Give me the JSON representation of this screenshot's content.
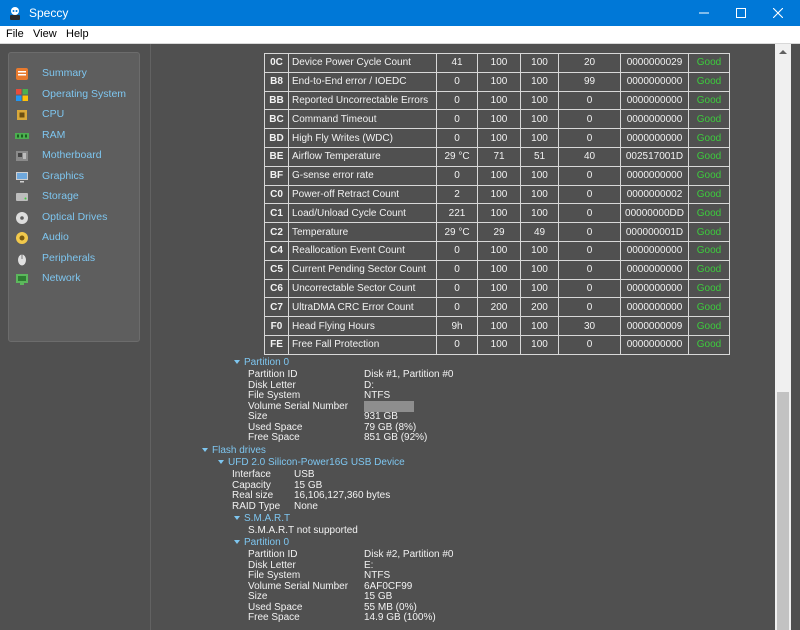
{
  "window": {
    "title": "Speccy"
  },
  "menu": [
    "File",
    "View",
    "Help"
  ],
  "sidebar": [
    {
      "label": "Summary",
      "icon": "summary-icon",
      "color": "#e87a2e"
    },
    {
      "label": "Operating System",
      "icon": "windows-icon",
      "color": "#4fa3e0"
    },
    {
      "label": "CPU",
      "icon": "cpu-icon",
      "color": "#d9a83a"
    },
    {
      "label": "RAM",
      "icon": "ram-icon",
      "color": "#4caf50"
    },
    {
      "label": "Motherboard",
      "icon": "motherboard-icon",
      "color": "#8a8a8a"
    },
    {
      "label": "Graphics",
      "icon": "graphics-icon",
      "color": "#6fa8dc"
    },
    {
      "label": "Storage",
      "icon": "storage-icon",
      "color": "#bdbdbd"
    },
    {
      "label": "Optical Drives",
      "icon": "optical-drive-icon",
      "color": "#dddddd"
    },
    {
      "label": "Audio",
      "icon": "audio-icon",
      "color": "#f2c94c"
    },
    {
      "label": "Peripherals",
      "icon": "peripherals-icon",
      "color": "#e0e0e0"
    },
    {
      "label": "Network",
      "icon": "network-icon",
      "color": "#5cb85c"
    }
  ],
  "smart_rows": [
    {
      "id": "0C",
      "name": "Device Power Cycle Count",
      "current": "41",
      "worst": "100",
      "threshold": "100",
      "low": "20",
      "raw": "0000000029",
      "status": "Good"
    },
    {
      "id": "B8",
      "name": "End-to-End error / IOEDC",
      "current": "0",
      "worst": "100",
      "threshold": "100",
      "low": "99",
      "raw": "0000000000",
      "status": "Good"
    },
    {
      "id": "BB",
      "name": "Reported Uncorrectable Errors",
      "current": "0",
      "worst": "100",
      "threshold": "100",
      "low": "0",
      "raw": "0000000000",
      "status": "Good"
    },
    {
      "id": "BC",
      "name": "Command Timeout",
      "current": "0",
      "worst": "100",
      "threshold": "100",
      "low": "0",
      "raw": "0000000000",
      "status": "Good"
    },
    {
      "id": "BD",
      "name": "High Fly Writes (WDC)",
      "current": "0",
      "worst": "100",
      "threshold": "100",
      "low": "0",
      "raw": "0000000000",
      "status": "Good"
    },
    {
      "id": "BE",
      "name": "Airflow Temperature",
      "current": "29 °C",
      "worst": "71",
      "threshold": "51",
      "low": "40",
      "raw": "002517001D",
      "status": "Good"
    },
    {
      "id": "BF",
      "name": "G-sense error rate",
      "current": "0",
      "worst": "100",
      "threshold": "100",
      "low": "0",
      "raw": "0000000000",
      "status": "Good"
    },
    {
      "id": "C0",
      "name": "Power-off Retract Count",
      "current": "2",
      "worst": "100",
      "threshold": "100",
      "low": "0",
      "raw": "0000000002",
      "status": "Good"
    },
    {
      "id": "C1",
      "name": "Load/Unload Cycle Count",
      "current": "221",
      "worst": "100",
      "threshold": "100",
      "low": "0",
      "raw": "00000000DD",
      "status": "Good"
    },
    {
      "id": "C2",
      "name": "Temperature",
      "current": "29 °C",
      "worst": "29",
      "threshold": "49",
      "low": "0",
      "raw": "000000001D",
      "status": "Good"
    },
    {
      "id": "C4",
      "name": "Reallocation Event Count",
      "current": "0",
      "worst": "100",
      "threshold": "100",
      "low": "0",
      "raw": "0000000000",
      "status": "Good"
    },
    {
      "id": "C5",
      "name": "Current Pending Sector Count",
      "current": "0",
      "worst": "100",
      "threshold": "100",
      "low": "0",
      "raw": "0000000000",
      "status": "Good"
    },
    {
      "id": "C6",
      "name": "Uncorrectable Sector Count",
      "current": "0",
      "worst": "100",
      "threshold": "100",
      "low": "0",
      "raw": "0000000000",
      "status": "Good"
    },
    {
      "id": "C7",
      "name": "UltraDMA CRC Error Count",
      "current": "0",
      "worst": "200",
      "threshold": "200",
      "low": "0",
      "raw": "0000000000",
      "status": "Good"
    },
    {
      "id": "F0",
      "name": "Head Flying Hours",
      "current": "9h",
      "worst": "100",
      "threshold": "100",
      "low": "30",
      "raw": "0000000009",
      "status": "Good"
    },
    {
      "id": "FE",
      "name": "Free Fall Protection",
      "current": "0",
      "worst": "100",
      "threshold": "100",
      "low": "0",
      "raw": "0000000000",
      "status": "Good"
    }
  ],
  "partition1": {
    "heading": "Partition 0",
    "labels": [
      "Partition ID",
      "Disk Letter",
      "File System",
      "Volume Serial Number",
      "Size",
      "Used Space",
      "Free Space"
    ],
    "values": [
      "Disk #1, Partition #0",
      "D:",
      "NTFS",
      "",
      "931 GB",
      "79 GB (8%)",
      "851 GB (92%)"
    ]
  },
  "flash": {
    "heading": "Flash drives",
    "device": "UFD 2.0 Silicon-Power16G USB Device",
    "labels": [
      "Interface",
      "Capacity",
      "Real size",
      "RAID Type"
    ],
    "values": [
      "USB",
      "15 GB",
      "16,106,127,360 bytes",
      "None"
    ],
    "smart_heading": "S.M.A.R.T",
    "smart_text": "S.M.A.R.T not supported"
  },
  "partition2": {
    "heading": "Partition 0",
    "labels": [
      "Partition ID",
      "Disk Letter",
      "File System",
      "Volume Serial Number",
      "Size",
      "Used Space",
      "Free Space"
    ],
    "values": [
      "Disk #2, Partition #0",
      "E:",
      "NTFS",
      "6AF0CF99",
      "15 GB",
      "55 MB (0%)",
      "14.9 GB (100%)"
    ]
  }
}
